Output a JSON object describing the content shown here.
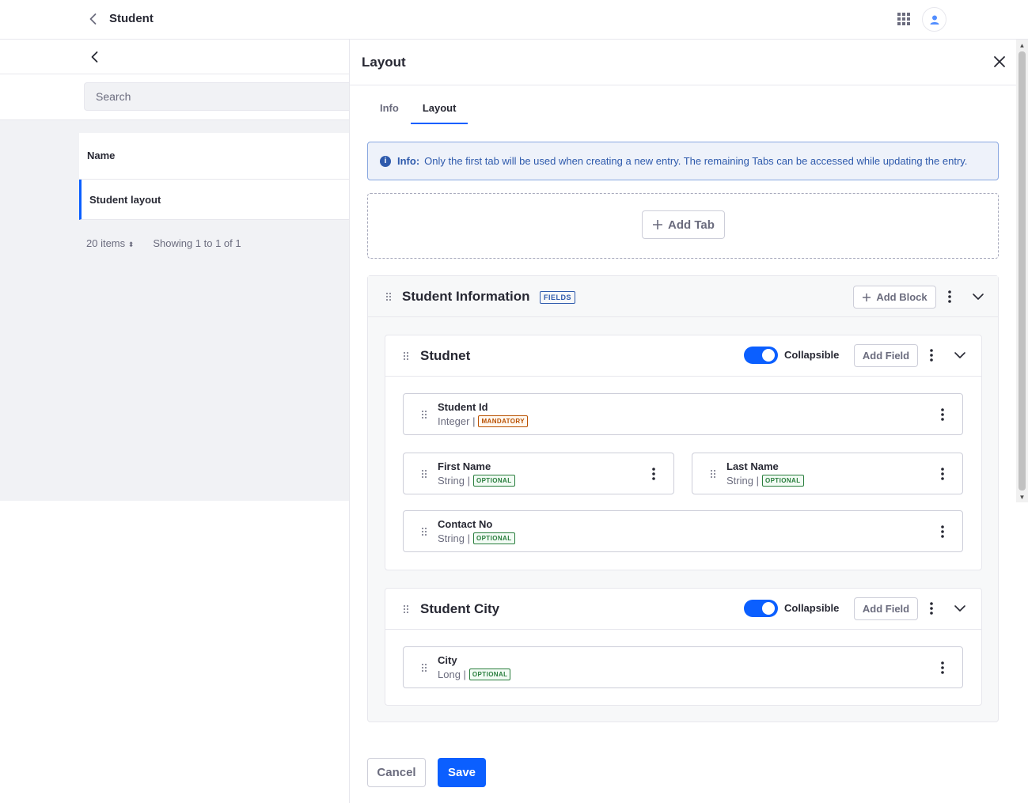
{
  "header": {
    "title": "Student"
  },
  "list": {
    "search_placeholder": "Search",
    "column_name": "Name",
    "rows": [
      "Student layout"
    ],
    "items_per_page": "20 items",
    "showing": "Showing 1 to 1 of 1"
  },
  "modal": {
    "title": "Layout",
    "tabs": [
      "Info",
      "Layout"
    ],
    "active_tab": "Layout",
    "info_label": "Info:",
    "info_text": "Only the first tab will be used when creating a new entry. The remaining Tabs can be accessed while updating the entry.",
    "add_tab_label": "Add Tab",
    "tab_panel": {
      "title": "Student Information",
      "badge": "FIELDS",
      "add_block_label": "Add Block",
      "blocks": [
        {
          "title": "Studnet",
          "collapsible_label": "Collapsible",
          "collapsible_on": true,
          "add_field_label": "Add Field",
          "fields": [
            {
              "name": "Student Id",
              "type": "Integer |",
              "tag": "MANDATORY"
            },
            {
              "name": "First Name",
              "type": "String |",
              "tag": "OPTIONAL"
            },
            {
              "name": "Last Name",
              "type": "String |",
              "tag": "OPTIONAL"
            },
            {
              "name": "Contact No",
              "type": "String |",
              "tag": "OPTIONAL"
            }
          ]
        },
        {
          "title": "Student City",
          "collapsible_label": "Collapsible",
          "collapsible_on": true,
          "add_field_label": "Add Field",
          "fields": [
            {
              "name": "City",
              "type": "Long |",
              "tag": "OPTIONAL"
            }
          ]
        }
      ]
    },
    "cancel_label": "Cancel",
    "save_label": "Save"
  },
  "colors": {
    "accent": "#0b5fff",
    "info_bg": "#eef2fa",
    "info_text": "#2e5aac",
    "mandatory": "#b95000",
    "optional": "#287d3c"
  },
  "icons": [
    "chevron-left-icon",
    "apps-grid-icon",
    "user-icon",
    "close-icon",
    "info-circle-icon",
    "plus-icon",
    "drag-handle-icon",
    "kebab-icon",
    "chevron-down-icon",
    "caret-double-icon"
  ]
}
